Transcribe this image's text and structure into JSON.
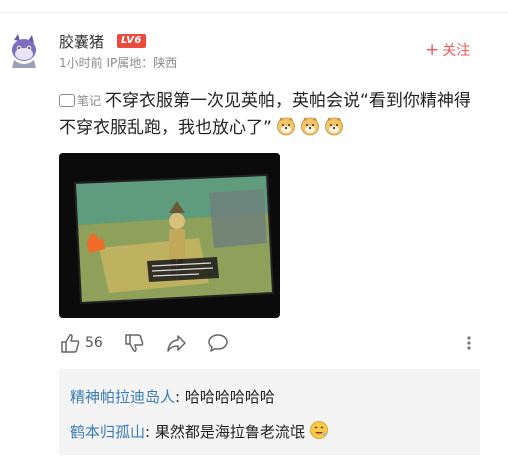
{
  "comment": {
    "username": "胶囊猪",
    "level_badge": "LV6",
    "time": "1小时前",
    "ip_location": "IP属地：陕西",
    "follow_label": "关注",
    "note_tag": "笔记",
    "text": "不穿衣服第一次见英帕，英帕会说“看到你精神得不穿衣服乱跑，我也放心了”",
    "emojis": [
      "doge-icon",
      "doge-icon",
      "doge-icon"
    ]
  },
  "actions": {
    "like_count": "56"
  },
  "replies": [
    {
      "name": "精神帕拉迪岛人",
      "sep": ":",
      "text": " 哈哈哈哈哈哈"
    },
    {
      "name": "鹤本归孤山",
      "sep": ":",
      "text": " 果然都是海拉鲁老流氓"
    }
  ],
  "colors": {
    "accent": "#ef5a5a",
    "level_badge": "#ea4b3f",
    "reply_name": "#3b7bb5",
    "reply_bg": "#f4f4f4"
  }
}
